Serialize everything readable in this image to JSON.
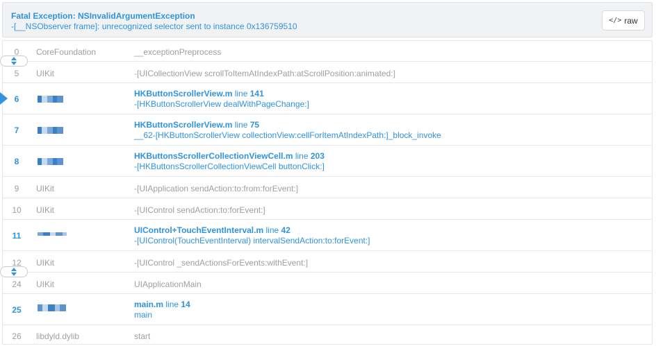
{
  "exception": {
    "title": "Fatal Exception: NSInvalidArgumentException",
    "message": "-[__NSObserver frame]: unrecognized selector sent to instance 0x136759510"
  },
  "raw_button": {
    "icon": "code-icon",
    "icon_glyph": "</>",
    "label": "raw"
  },
  "frames": [
    {
      "num": "0",
      "module": "CoreFoundation",
      "symbol": "__exceptionPreprocess"
    },
    {
      "num": "5",
      "module": "UIKit",
      "symbol": "-[UICollectionView scrollToItemAtIndexPath:atScrollPosition:animated:]"
    },
    {
      "num": "6",
      "file": "HKButtonScrollerView.m",
      "line_word": "line",
      "line": "141",
      "method": "-[HKButtonScrollerView dealWithPageChange:]"
    },
    {
      "num": "7",
      "file": "HKButtonScrollerView.m",
      "line_word": "line",
      "line": "75",
      "method": "__62-[HKButtonScrollerView collectionView:cellForItemAtIndexPath:]_block_invoke"
    },
    {
      "num": "8",
      "file": "HKButtonsScrollerCollectionViewCell.m",
      "line_word": "line",
      "line": "203",
      "method": "-[HKButtonsScrollerCollectionViewCell buttonClick:]"
    },
    {
      "num": "9",
      "module": "UIKit",
      "symbol": "-[UIApplication sendAction:to:from:forEvent:]"
    },
    {
      "num": "10",
      "module": "UIKit",
      "symbol": "-[UIControl sendAction:to:forEvent:]"
    },
    {
      "num": "11",
      "file": "UIControl+TouchEventInterval.m",
      "line_word": "line",
      "line": "42",
      "method": "-[UIControl(TouchEventInterval) intervalSendAction:to:forEvent:]"
    },
    {
      "num": "12",
      "module": "UIKit",
      "symbol": "-[UIControl _sendActionsForEvents:withEvent:]"
    },
    {
      "num": "24",
      "module": "UIKit",
      "symbol": "UIApplicationMain"
    },
    {
      "num": "25",
      "file": "main.m",
      "line_word": "line",
      "line": "14",
      "method": "main"
    },
    {
      "num": "26",
      "module": "libdyld.dylib",
      "symbol": "start"
    }
  ],
  "colors": {
    "accent": "#2f93e0",
    "muted": "#9aa0a6",
    "header_bg": "#f0f2f4",
    "border": "#e3e6ea"
  }
}
